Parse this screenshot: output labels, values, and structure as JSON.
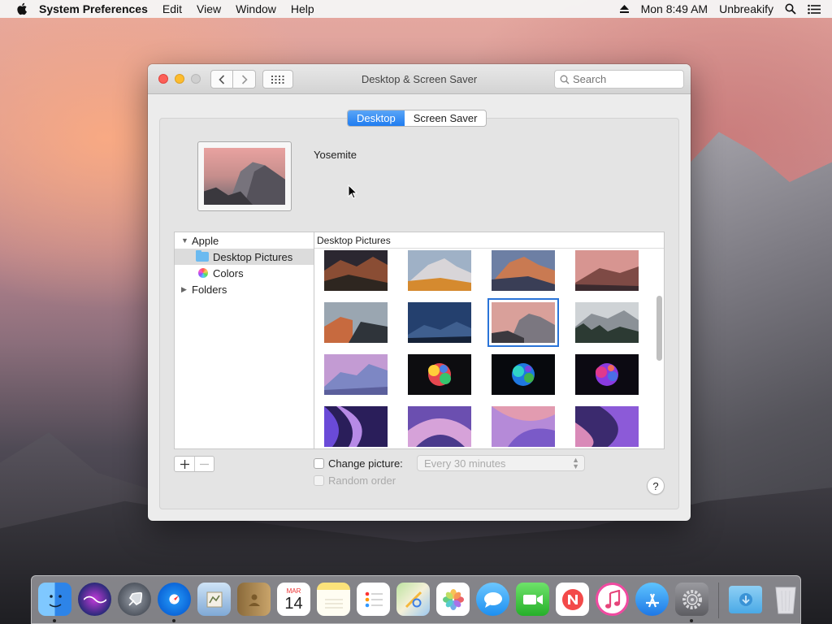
{
  "menubar": {
    "app_name": "System Preferences",
    "menus": [
      "Edit",
      "View",
      "Window",
      "Help"
    ],
    "clock": "Mon 8:49 AM",
    "user": "Unbreakify"
  },
  "window": {
    "title": "Desktop & Screen Saver",
    "search_placeholder": "Search",
    "tabs": [
      {
        "label": "Desktop",
        "active": true
      },
      {
        "label": "Screen Saver",
        "active": false
      }
    ],
    "current_picture": "Yosemite",
    "source_list": {
      "group": "Apple",
      "items": [
        "Desktop Pictures",
        "Colors"
      ],
      "folders": "Folders"
    },
    "pictures_header": "Desktop Pictures",
    "change_picture_label": "Change picture:",
    "interval": "Every 30 minutes",
    "random_order_label": "Random order",
    "help": "?"
  },
  "dock": {
    "calendar_month": "MAR",
    "calendar_day": "14"
  }
}
